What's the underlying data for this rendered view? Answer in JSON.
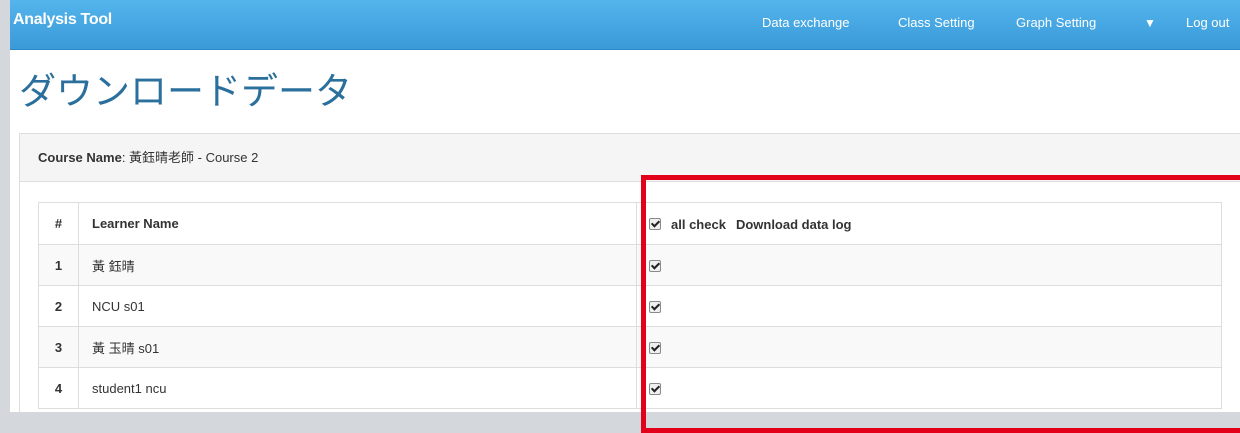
{
  "navbar": {
    "brand": "Analysis Tool",
    "items": [
      "Data exchange",
      "Class Setting",
      "Graph Setting"
    ],
    "caret": "▼",
    "logout": "Log out"
  },
  "page_title": "ダウンロードデータ",
  "course": {
    "label": "Course Name",
    "value": ": 黃鈺晴老師 - Course 2"
  },
  "table": {
    "headers": {
      "num": "#",
      "name": "Learner Name",
      "all_check": "all check",
      "download": "Download data log"
    },
    "all_checked": true,
    "rows": [
      {
        "num": "1",
        "name": "黃 鈺晴",
        "checked": true
      },
      {
        "num": "2",
        "name": "NCU s01",
        "checked": true
      },
      {
        "num": "3",
        "name": "黃 玉晴 s01",
        "checked": true
      },
      {
        "num": "4",
        "name": "student1 ncu",
        "checked": true
      }
    ]
  },
  "colors": {
    "navbar": "#3a9ad9",
    "title": "#2b6f9c",
    "highlight": "#e3001b"
  }
}
